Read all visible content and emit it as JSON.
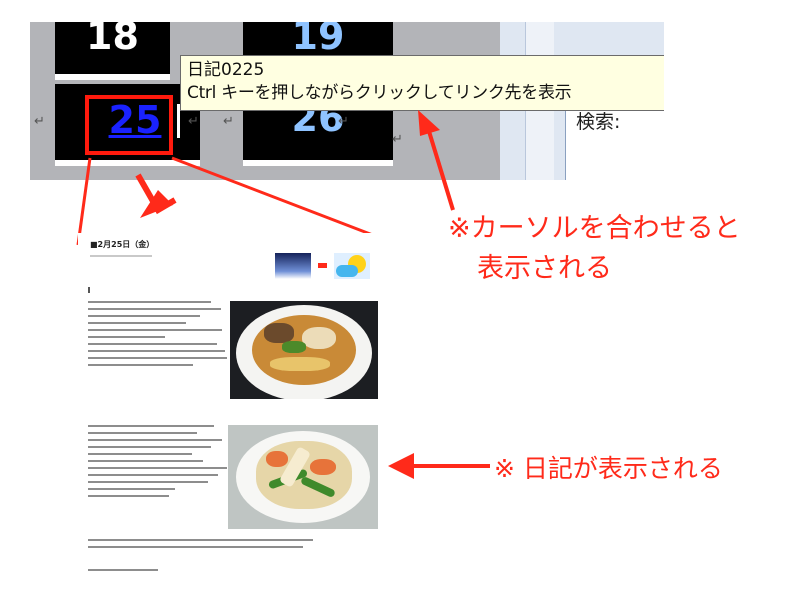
{
  "calendar": {
    "day_18": "18",
    "day_19_partial": "19",
    "day_25": "25",
    "day_26": "26",
    "pilcrow": "↵"
  },
  "tooltip": {
    "line1": "日記0225",
    "line2": "Ctrl キーを押しながらクリックしてリンク先を表示"
  },
  "right_panel": {
    "search_label": "検索:"
  },
  "annotations": {
    "hover_line1": "※カーソルを合わせると",
    "hover_line2": "表示される",
    "diary_note": "※ 日記が表示される"
  },
  "diary": {
    "title": "■2月25日（金）"
  },
  "colors": {
    "annotation": "#ff2a1a",
    "tooltip_bg": "#ffffe1",
    "link_number": "#1a22ff",
    "day_number": "#8fc3ff",
    "calendar_cell": "#000000"
  }
}
